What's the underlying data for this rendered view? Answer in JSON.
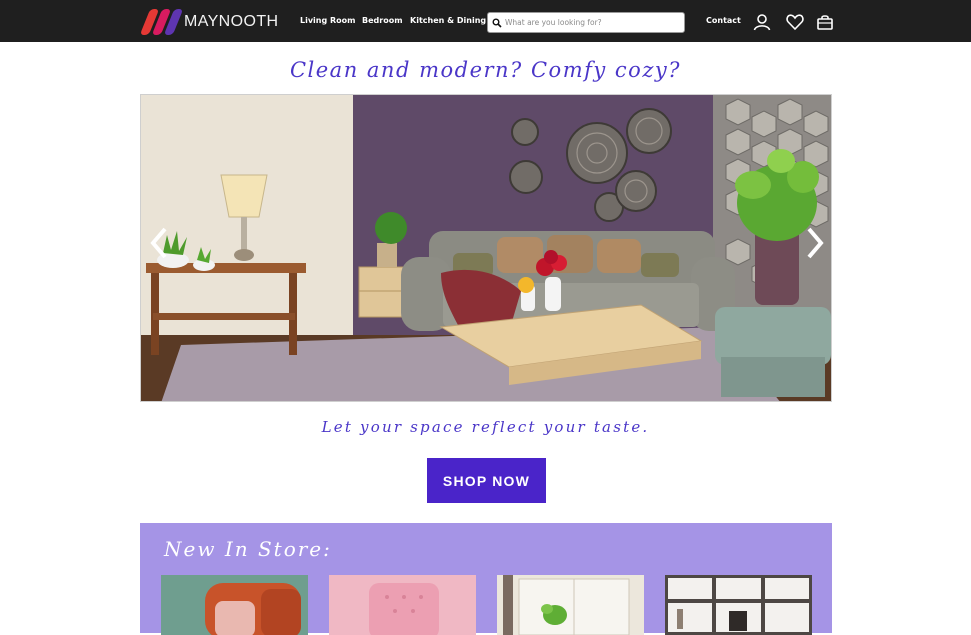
{
  "brand": {
    "name": "MAYNOOTH",
    "colors": {
      "nav_bg": "#1f1f1f",
      "accent": "#4a24c9",
      "store_bg": "#a594e6",
      "headline": "#4a36c8"
    }
  },
  "nav": {
    "links": [
      "Living Room",
      "Bedroom",
      "Kitchen & Dining"
    ],
    "contact": "Contact",
    "search": {
      "placeholder": "What are you looking for?",
      "value": ""
    },
    "icons": [
      "search-icon",
      "user-icon",
      "heart-icon",
      "shopping-bag-icon"
    ]
  },
  "hero": {
    "headline": "Clean and modern? Comfy cozy?",
    "tagline": "Let your space reflect your taste.",
    "cta": "SHOP NOW",
    "carousel_icons": [
      "chevron-left-icon",
      "chevron-right-icon"
    ]
  },
  "new_in_store": {
    "title": "New In Store:",
    "products": [
      "orange-armchair",
      "pink-tufted-chair",
      "plant-by-window",
      "bookshelf"
    ]
  }
}
